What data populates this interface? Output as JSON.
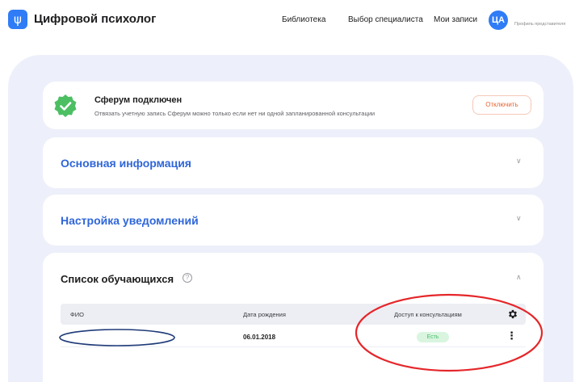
{
  "header": {
    "logo_glyph": "ψ",
    "app_title": "Цифровой психолог",
    "nav": [
      "Библиотека",
      "Выбор специалиста",
      "Мои записи"
    ],
    "avatar_initials": "ЦА",
    "profile_caption": "Профиль представителя"
  },
  "sferum": {
    "title": "Сферум подключен",
    "subtitle": "Отвязать учетную запись Сферум можно только если нет ни одной запланированной консультации",
    "button_label": "Отключить",
    "icon": "check-badge-icon",
    "status_color": "#4cbf63"
  },
  "sections": {
    "basic_info": "Основная информация",
    "notifications": "Настройка уведомлений"
  },
  "students": {
    "title": "Список обучающихся",
    "help_glyph": "?",
    "columns": [
      "ФИО",
      "Дата рождения",
      "Доступ к консультациям"
    ],
    "rows": [
      {
        "name": "",
        "birth_date": "06.01.2018",
        "access": "Есть"
      }
    ]
  },
  "colors": {
    "accent": "#2f7cf6",
    "heading_blue": "#2f66d8",
    "panel_bg": "#edf0fa",
    "danger": "#e8622f",
    "annotation_red": "#e5262a",
    "annotation_blue": "#1f3a78"
  }
}
